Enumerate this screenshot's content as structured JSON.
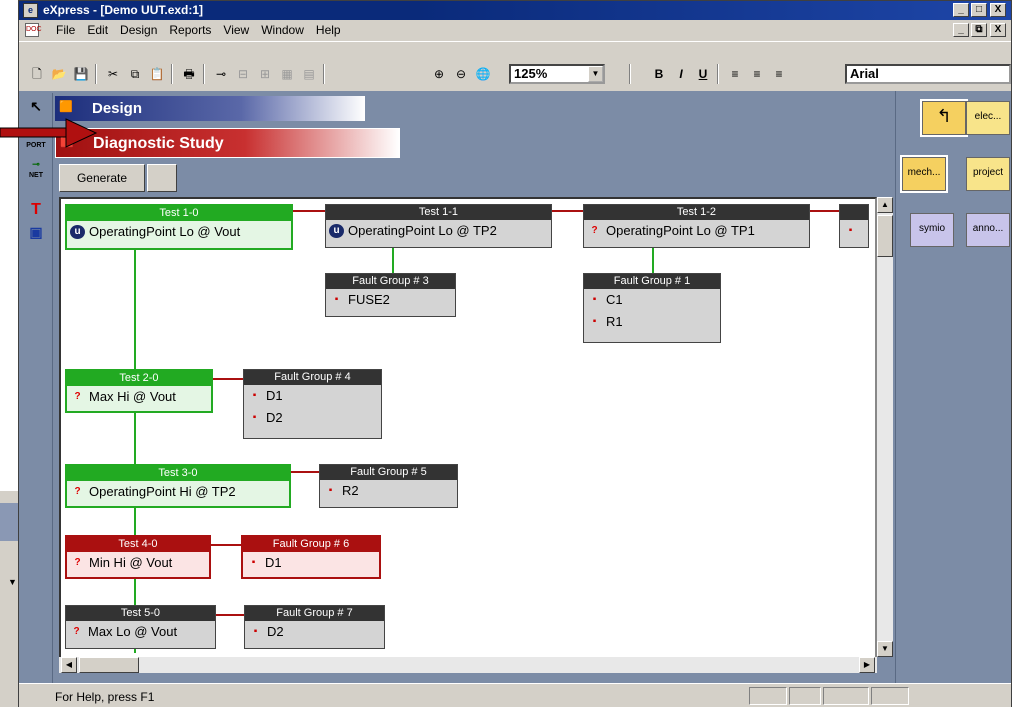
{
  "window": {
    "title": "eXpress - [Demo UUT.exd:1]",
    "minimize": "_",
    "maximize": "□",
    "close": "X",
    "restore": "⧉"
  },
  "menu": [
    "File",
    "Edit",
    "Design",
    "Reports",
    "View",
    "Window",
    "Help"
  ],
  "toolbar": {
    "zoom": "125%",
    "font": "Arial",
    "bold": "B",
    "italic": "I",
    "underline": "U"
  },
  "left_tools": {
    "port": "PORT",
    "net": "NET",
    "text": "T"
  },
  "design_header": "Design",
  "diagnostic_header": "Diagnostic Study",
  "generate_button": "Generate",
  "tests": [
    {
      "label": "Test 1-0",
      "text": "OperatingPoint Lo @ Vout",
      "state": "green"
    },
    {
      "label": "Test 1-1",
      "text": "OperatingPoint Lo @ TP2",
      "state": "dark"
    },
    {
      "label": "Test 1-2",
      "text": "OperatingPoint Lo @ TP1",
      "state": "dark"
    },
    {
      "label": "Test 2-0",
      "text": "Max Hi @ Vout",
      "state": "green"
    },
    {
      "label": "Test 3-0",
      "text": "OperatingPoint Hi @ TP2",
      "state": "green"
    },
    {
      "label": "Test 4-0",
      "text": "Min Hi @ Vout",
      "state": "red"
    },
    {
      "label": "Test 5-0",
      "text": "Max Lo @ Vout",
      "state": "dark"
    }
  ],
  "fault_groups": [
    {
      "label": "Fault Group # 3",
      "items": [
        "FUSE2"
      ],
      "state": "dark"
    },
    {
      "label": "Fault Group # 1",
      "items": [
        "C1",
        "R1"
      ],
      "state": "dark"
    },
    {
      "label": "Fault Group # 4",
      "items": [
        "D1",
        "D2"
      ],
      "state": "dark"
    },
    {
      "label": "Fault Group # 5",
      "items": [
        "R2"
      ],
      "state": "dark"
    },
    {
      "label": "Fault Group # 6",
      "items": [
        "D1"
      ],
      "state": "red"
    },
    {
      "label": "Fault Group # 7",
      "items": [
        "D2"
      ],
      "state": "dark"
    }
  ],
  "palette": [
    "elec...",
    "mech...",
    "project",
    "symio",
    "anno..."
  ],
  "status": "For Help, press F1",
  "icons": {
    "u": "u",
    "q": "?",
    "comp": "▪"
  }
}
